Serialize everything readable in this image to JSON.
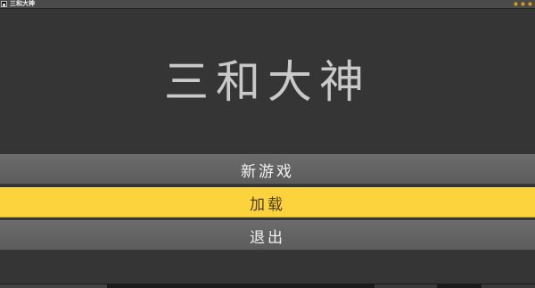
{
  "window": {
    "title": "三和大神"
  },
  "game": {
    "title": "三和大神"
  },
  "menu": {
    "items": [
      {
        "label": "新游戏"
      },
      {
        "label": "加载"
      },
      {
        "label": "退出"
      }
    ],
    "selected_index": 1
  },
  "colors": {
    "background": "#353535",
    "button": "#626262",
    "button_selected": "#fdd33d",
    "title_text": "#c9c9c9",
    "window_controls": "#d6a73a"
  }
}
